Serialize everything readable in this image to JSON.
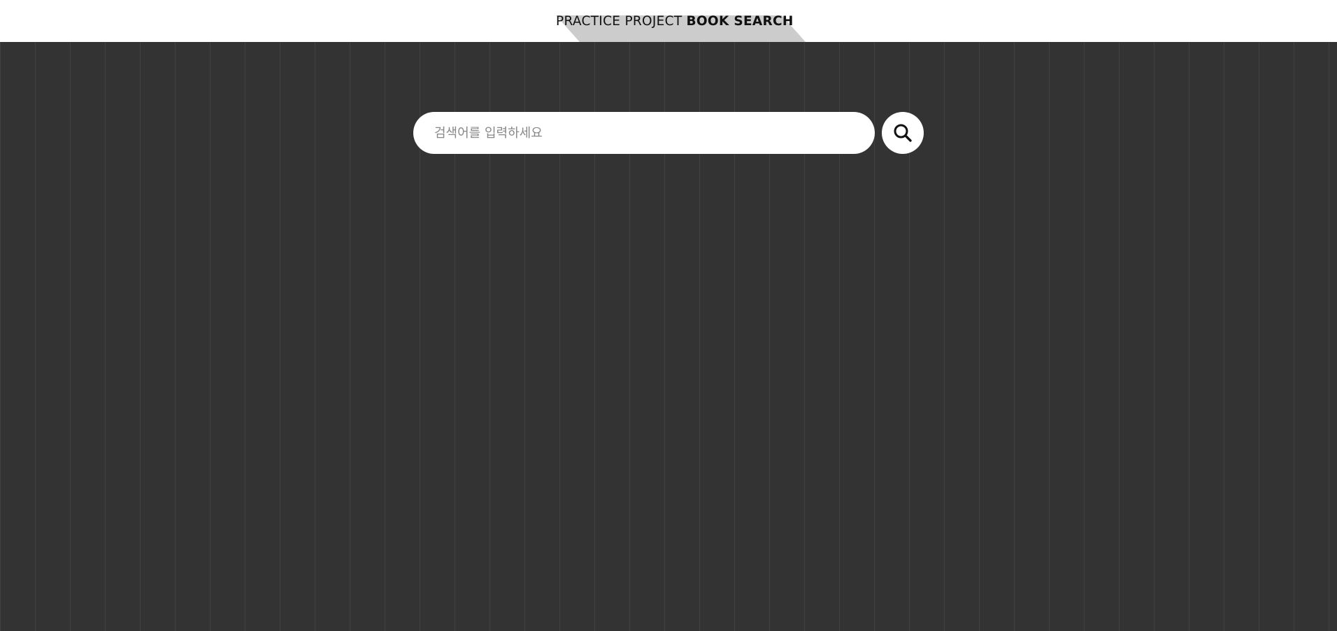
{
  "header": {
    "title_prefix": "PRACTICE PROJECT",
    "title_main": "BOOK SEARCH"
  },
  "search": {
    "placeholder": "검색어를 입력하세요",
    "value": "",
    "button_icon": "search-icon"
  },
  "colors": {
    "background": "#333333",
    "header_background": "#ffffff",
    "title_shadow": "#cccccc",
    "input_background": "#ffffff"
  }
}
